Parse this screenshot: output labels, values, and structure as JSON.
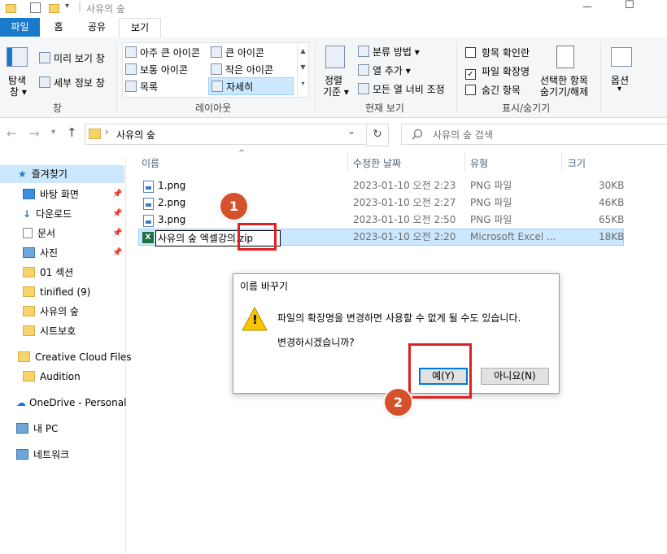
{
  "titlebar": {
    "separator": "|",
    "title": "사유의 숲",
    "dropdown": "▾"
  },
  "window_controls": {
    "minimize": "—",
    "maximize": "☐"
  },
  "ribbon_tabs": [
    "파일",
    "홈",
    "공유",
    "보기"
  ],
  "ribbon": {
    "panes_group": {
      "nav_pane_line1": "탐색",
      "nav_pane_line2": "창 ▾",
      "preview": "미리 보기 창",
      "details": "세부 정보 창",
      "label": "창"
    },
    "layout_group": {
      "items": [
        "아주 큰 아이콘",
        "큰 아이콘",
        "보통 아이콘",
        "작은 아이콘",
        "목록",
        "자세히"
      ],
      "selected": "자세히",
      "label": "레이아웃"
    },
    "view_group": {
      "sort_line1": "정렬",
      "sort_line2": "기준 ▾",
      "group_by": "분류 방법 ▾",
      "add_column": "열 추가 ▾",
      "fit_columns": "모든 열 너비 조정",
      "label": "현재 보기"
    },
    "show_group": {
      "checkboxes": [
        {
          "label": "항목 확인란",
          "checked": false
        },
        {
          "label": "파일 확장명",
          "checked": true
        },
        {
          "label": "숨긴 항목",
          "checked": false
        }
      ],
      "hide_selected_line1": "선택한 항목",
      "hide_selected_line2": "숨기기/해제",
      "label": "표시/숨기기"
    },
    "options": {
      "line1": "옵션",
      "line2": "▾"
    }
  },
  "address": {
    "back": "←",
    "forward": "→",
    "recent": "▾",
    "up": "↑",
    "chevron": "›",
    "path": "사유의 숲",
    "dropdown": "⌄",
    "refresh": "↻",
    "search_placeholder": "사유의 숲 검색"
  },
  "nav_pane": {
    "quick_access": "즐겨찾기",
    "items": [
      {
        "label": "바탕 화면",
        "pinned": true
      },
      {
        "label": "다운로드",
        "pinned": true
      },
      {
        "label": "문서",
        "pinned": true
      },
      {
        "label": "사진",
        "pinned": true
      },
      {
        "label": "01 섹션",
        "pinned": false
      },
      {
        "label": "tinified (9)",
        "pinned": false
      },
      {
        "label": "사유의 숲",
        "pinned": false
      },
      {
        "label": "시트보호",
        "pinned": false
      }
    ],
    "creative_cloud": "Creative Cloud Files",
    "audition": "Audition",
    "onedrive": "OneDrive - Personal",
    "this_pc": "내 PC",
    "network": "네트워크"
  },
  "file_list": {
    "columns": [
      "이름",
      "수정한 날짜",
      "유형",
      "크기"
    ],
    "sort_indicator": "^",
    "rows": [
      {
        "name": "1.png",
        "date": "2023-01-10 오전 2:23",
        "type": "PNG 파일",
        "size": "30KB"
      },
      {
        "name": "2.png",
        "date": "2023-01-10 오전 2:27",
        "type": "PNG 파일",
        "size": "46KB"
      },
      {
        "name": "3.png",
        "date": "2023-01-10 오전 2:50",
        "type": "PNG 파일",
        "size": "65KB"
      },
      {
        "name": "사유의 숲 엑셀강의.zip",
        "date": "2023-01-10 오전 2:20",
        "type": "Microsoft Excel ...",
        "size": "18KB"
      }
    ],
    "rename_value_base": "사유의 숲 엑셀강의",
    "rename_value_ext": ".zip"
  },
  "dialog": {
    "title": "이름 바꾸기",
    "message": "파일의 확장명을 변경하면 사용할 수 없게 될 수도 있습니다.",
    "question": "변경하시겠습니까?",
    "warning_glyph": "!",
    "yes": "예(Y)",
    "no": "아니요(N)"
  },
  "annotations": {
    "marker1": "1",
    "marker2": "2",
    "color": "#e02020"
  }
}
